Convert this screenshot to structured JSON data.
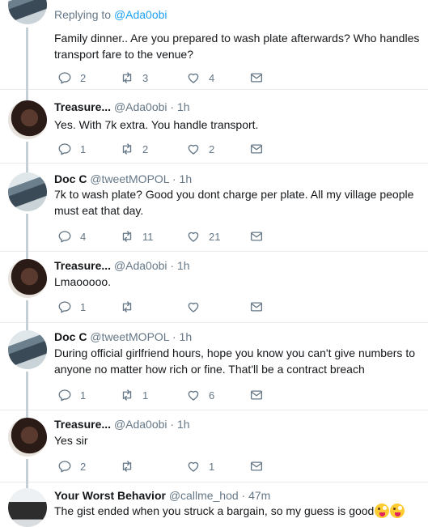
{
  "tweets": [
    {
      "replying_prefix": "Replying to",
      "replying_handle": "@Ada0obi",
      "text": "Family dinner.. Are you prepared to wash plate afterwards? Who handles transport fare to the venue?",
      "replies": "2",
      "retweets": "3",
      "likes": "4"
    },
    {
      "name": "Treasure...",
      "handle": "@Ada0obi",
      "time": "1h",
      "text": "Yes. With 7k extra. You handle transport.",
      "replies": "1",
      "retweets": "2",
      "likes": "2"
    },
    {
      "name": "Doc C",
      "handle": "@tweetMOPOL",
      "time": "1h",
      "text": "7k to wash plate? Good you dont charge per plate. All my village people must eat that day.",
      "replies": "4",
      "retweets": "11",
      "likes": "21"
    },
    {
      "name": "Treasure...",
      "handle": "@Ada0obi",
      "time": "1h",
      "text": "Lmaooooo.",
      "replies": "1",
      "retweets": "",
      "likes": ""
    },
    {
      "name": "Doc C",
      "handle": "@tweetMOPOL",
      "time": "1h",
      "text": "During official girlfriend hours, hope you know you can't give numbers to anyone no matter how rich or fine. That'll be a contract breach",
      "replies": "1",
      "retweets": "1",
      "likes": "6"
    },
    {
      "name": "Treasure...",
      "handle": "@Ada0obi",
      "time": "1h",
      "text": "Yes sir",
      "replies": "2",
      "retweets": "",
      "likes": "1"
    },
    {
      "name": "Your Worst Behavior",
      "handle": "@callme_hod",
      "time": "47m",
      "text": "The gist ended when you struck a bargain, so my guess is good"
    }
  ],
  "separator": "·",
  "icons": {
    "reply": "reply-icon",
    "retweet": "retweet-icon",
    "like": "heart-icon",
    "dm": "envelope-icon",
    "emoji": "winking-tongue-face-emoji"
  },
  "colors": {
    "link": "#1da1f2",
    "muted": "#657786",
    "thread_line": "#c4cfd6",
    "text": "#14171a"
  }
}
